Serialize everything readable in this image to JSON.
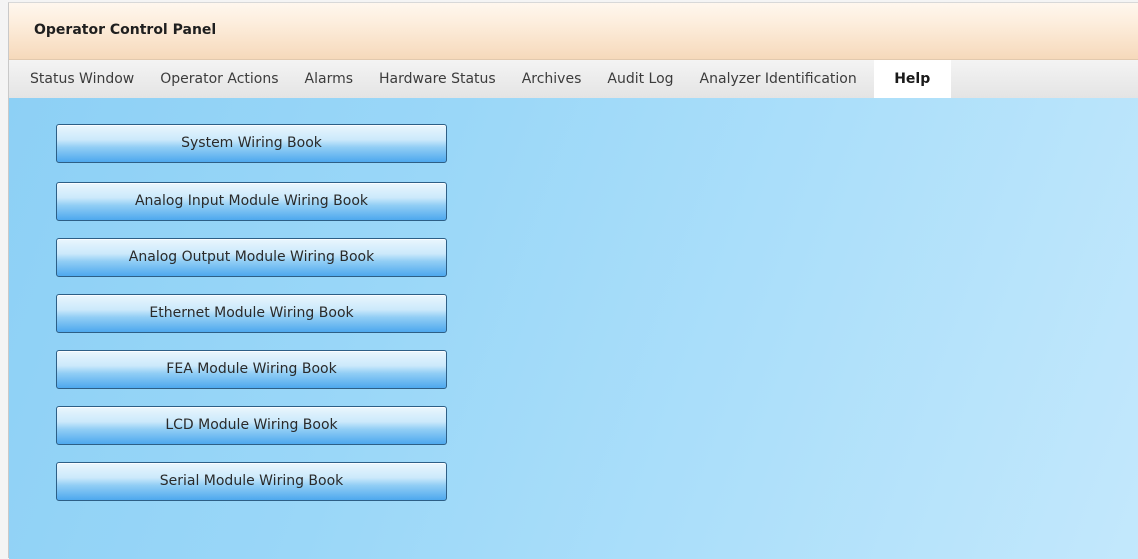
{
  "window": {
    "title": "Operator Control Panel"
  },
  "tabs": [
    {
      "label": "Status Window",
      "active": false
    },
    {
      "label": "Operator Actions",
      "active": false
    },
    {
      "label": "Alarms",
      "active": false
    },
    {
      "label": "Hardware Status",
      "active": false
    },
    {
      "label": "Archives",
      "active": false
    },
    {
      "label": "Audit Log",
      "active": false
    },
    {
      "label": "Analyzer Identification",
      "active": false
    },
    {
      "label": "Help",
      "active": true
    }
  ],
  "help_buttons": [
    {
      "label": "System Wiring Book"
    },
    {
      "label": "Analog Input Module Wiring Book"
    },
    {
      "label": "Analog Output Module Wiring Book"
    },
    {
      "label": "Ethernet Module Wiring Book"
    },
    {
      "label": "FEA Module Wiring Book"
    },
    {
      "label": "LCD Module Wiring Book"
    },
    {
      "label": "Serial Module Wiring Book"
    }
  ],
  "colors": {
    "content_background": "#9ad7f8",
    "button_accent": "#4ea8ee",
    "titlebar": "#f6d9bb"
  }
}
